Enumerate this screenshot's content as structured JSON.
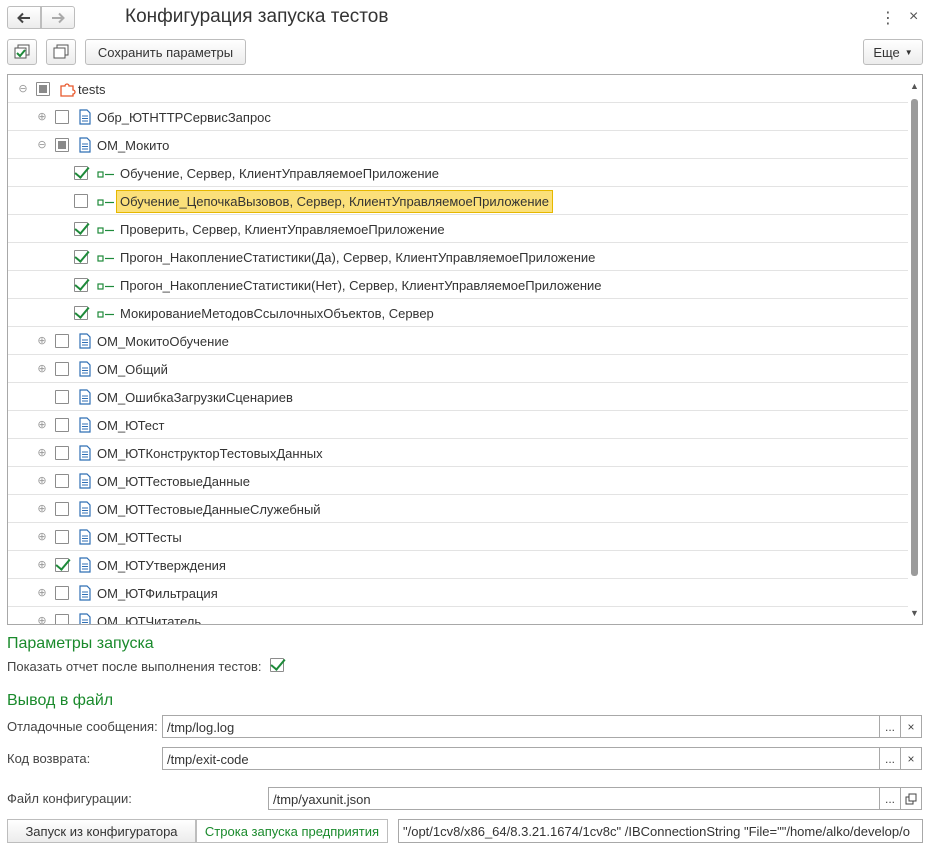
{
  "window": {
    "title": "Конфигурация запуска тестов",
    "back_icon": "arrow-left-icon",
    "forward_icon": "arrow-right-icon",
    "more_icon": "⋮",
    "close_icon": "×"
  },
  "toolbar": {
    "save_label": "Сохранить параметры",
    "more_label": "Еще"
  },
  "tree": {
    "rows": [
      {
        "label": "tests",
        "level": 0,
        "expander": "⊖",
        "checkbox": "partial",
        "icon": "puzzle-icon"
      },
      {
        "label": "Обр_ЮТHTTPСервисЗапрос",
        "level": 1,
        "expander": "⊕",
        "checkbox": "unchecked",
        "icon": "document-icon"
      },
      {
        "label": "ОМ_Мокито",
        "level": 1,
        "expander": "⊖",
        "checkbox": "partial",
        "icon": "document-icon"
      },
      {
        "label": "Обучение, Сервер, КлиентУправляемоеПриложение",
        "level": 2,
        "checkbox": "checked",
        "icon": "test-method-icon"
      },
      {
        "label": "Обучение_ЦепочкаВызовов, Сервер, КлиентУправляемоеПриложение",
        "level": 2,
        "checkbox": "unchecked",
        "icon": "test-method-icon",
        "selected": true
      },
      {
        "label": "Проверить, Сервер, КлиентУправляемоеПриложение",
        "level": 2,
        "checkbox": "checked",
        "icon": "test-method-icon"
      },
      {
        "label": "Прогон_НакоплениеСтатистики(Да), Сервер, КлиентУправляемоеПриложение",
        "level": 2,
        "checkbox": "checked",
        "icon": "test-method-icon"
      },
      {
        "label": "Прогон_НакоплениеСтатистики(Нет), Сервер, КлиентУправляемоеПриложение",
        "level": 2,
        "checkbox": "checked",
        "icon": "test-method-icon"
      },
      {
        "label": "МокированиеМетодовСсылочныхОбъектов, Сервер",
        "level": 2,
        "checkbox": "checked",
        "icon": "test-method-icon"
      },
      {
        "label": "ОМ_МокитоОбучение",
        "level": 1,
        "expander": "⊕",
        "checkbox": "unchecked",
        "icon": "document-icon"
      },
      {
        "label": "ОМ_Общий",
        "level": 1,
        "expander": "⊕",
        "checkbox": "unchecked",
        "icon": "document-icon"
      },
      {
        "label": "ОМ_ОшибкаЗагрузкиСценариев",
        "level": 1,
        "checkbox": "unchecked",
        "icon": "document-icon"
      },
      {
        "label": "ОМ_ЮТест",
        "level": 1,
        "expander": "⊕",
        "checkbox": "unchecked",
        "icon": "document-icon"
      },
      {
        "label": "ОМ_ЮТКонструкторТестовыхДанных",
        "level": 1,
        "expander": "⊕",
        "checkbox": "unchecked",
        "icon": "document-icon"
      },
      {
        "label": "ОМ_ЮТТестовыеДанные",
        "level": 1,
        "expander": "⊕",
        "checkbox": "unchecked",
        "icon": "document-icon"
      },
      {
        "label": "ОМ_ЮТТестовыеДанныеСлужебный",
        "level": 1,
        "expander": "⊕",
        "checkbox": "unchecked",
        "icon": "document-icon"
      },
      {
        "label": "ОМ_ЮТТесты",
        "level": 1,
        "expander": "⊕",
        "checkbox": "unchecked",
        "icon": "document-icon"
      },
      {
        "label": "ОМ_ЮТУтверждения",
        "level": 1,
        "expander": "⊕",
        "checkbox": "checked",
        "icon": "document-icon"
      },
      {
        "label": "ОМ_ЮТФильтрация",
        "level": 1,
        "expander": "⊕",
        "checkbox": "unchecked",
        "icon": "document-icon"
      },
      {
        "label": "ОМ_ЮТЧитатель",
        "level": 1,
        "expander": "⊕",
        "checkbox": "unchecked",
        "icon": "document-icon"
      }
    ]
  },
  "launch": {
    "heading": "Параметры запуска",
    "show_report_label": "Показать отчет после выполнения тестов:",
    "show_report_checked": true
  },
  "output": {
    "heading": "Вывод в файл",
    "debug_label": "Отладочные сообщения:",
    "debug_value": "/tmp/log.log",
    "exit_label": "Код возврата:",
    "exit_value": "/tmp/exit-code",
    "config_label": "Файл конфигурации:",
    "config_value": "/tmp/yaxunit.json",
    "pick_btn": "...",
    "clear_btn": "×"
  },
  "bottom": {
    "run_from_configurator": "Запуск из конфигуратора",
    "enterprise_cmdline": "Строка запуска предприятия",
    "cmdline_value": "\"/opt/1cv8/x86_64/8.3.21.1674/1cv8c\"  /IBConnectionString \"File=\"\"/home/alko/develop/o"
  },
  "colors": {
    "accent_green": "#1a8a2c",
    "check_green": "#1e8a3a",
    "selection": "#fbe07a",
    "icon_blue": "#2f6fb5",
    "puzzle_orange": "#e8572b"
  }
}
